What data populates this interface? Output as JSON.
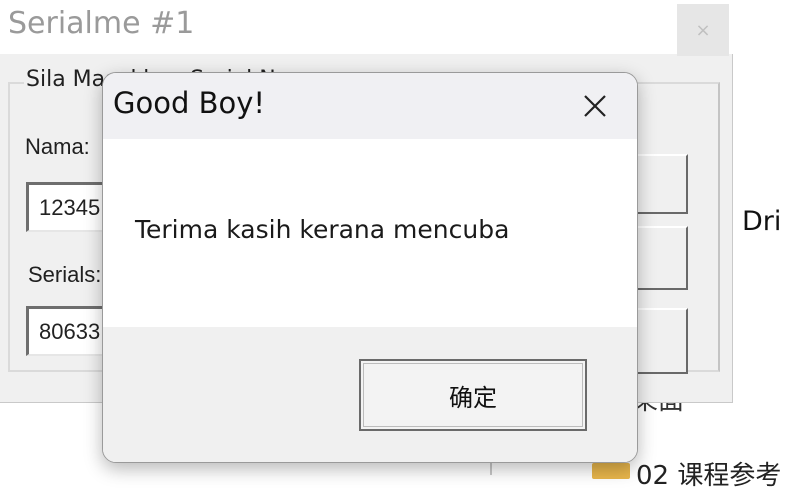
{
  "background": {
    "right_text": "Dri",
    "behind_text": "果面",
    "folder_label": "02 课程参考"
  },
  "serial_window": {
    "title": "Serialme #1",
    "close_symbol": "×",
    "group_legend": "Sila Masukkan Serial N",
    "name_label": "Nama:",
    "name_value": "12345",
    "serial_label": "Serials:",
    "serial_value": "80633"
  },
  "message_box": {
    "title": "Good Boy!",
    "message": "Terima kasih kerana mencuba",
    "ok_label": "确定",
    "close_icon": "close-x-icon"
  }
}
